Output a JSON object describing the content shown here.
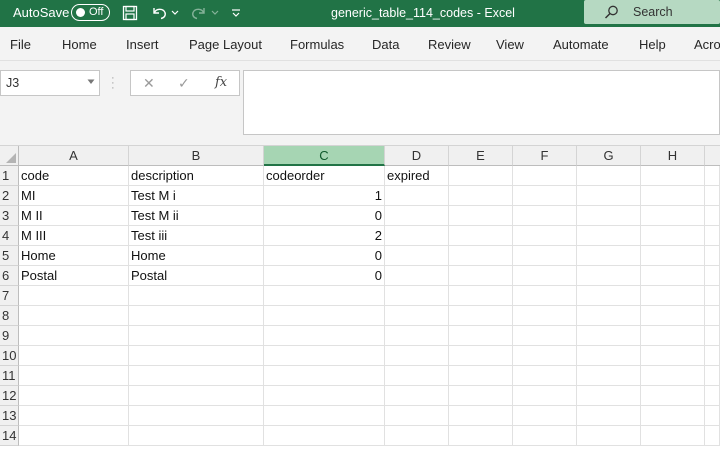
{
  "titlebar": {
    "autosave_label": "AutoSave",
    "autosave_state": "Off",
    "title": "generic_table_114_codes  -  Excel",
    "search_label": "Search",
    "icons": [
      "save-icon",
      "undo-icon",
      "redo-icon",
      "customize-icon",
      "search-icon"
    ]
  },
  "ribbon": {
    "tabs": [
      "File",
      "Home",
      "Insert",
      "Page Layout",
      "Formulas",
      "Data",
      "Review",
      "View",
      "Automate",
      "Help",
      "Acro"
    ]
  },
  "formula_bar": {
    "name_box": "J3",
    "fx_label": "fx",
    "content": ""
  },
  "sheet": {
    "columns": [
      "A",
      "B",
      "C",
      "D",
      "E",
      "F",
      "G",
      "H"
    ],
    "selected_column": "C",
    "rows": [
      "1",
      "2",
      "3",
      "4",
      "5",
      "6",
      "7",
      "8",
      "9",
      "10",
      "11",
      "12",
      "13",
      "14"
    ],
    "cells": [
      [
        "code",
        "description",
        "codeorder",
        "expired"
      ],
      [
        "MI",
        "Test M i",
        "1",
        ""
      ],
      [
        "M II",
        "Test M ii",
        "0",
        ""
      ],
      [
        "M III",
        "Test iii",
        "2",
        ""
      ],
      [
        "Home",
        "Home",
        "0",
        ""
      ],
      [
        "Postal",
        "Postal",
        "0",
        ""
      ]
    ]
  },
  "colors": {
    "excel_green": "#217346",
    "selected_header": "#a6d5b3"
  }
}
